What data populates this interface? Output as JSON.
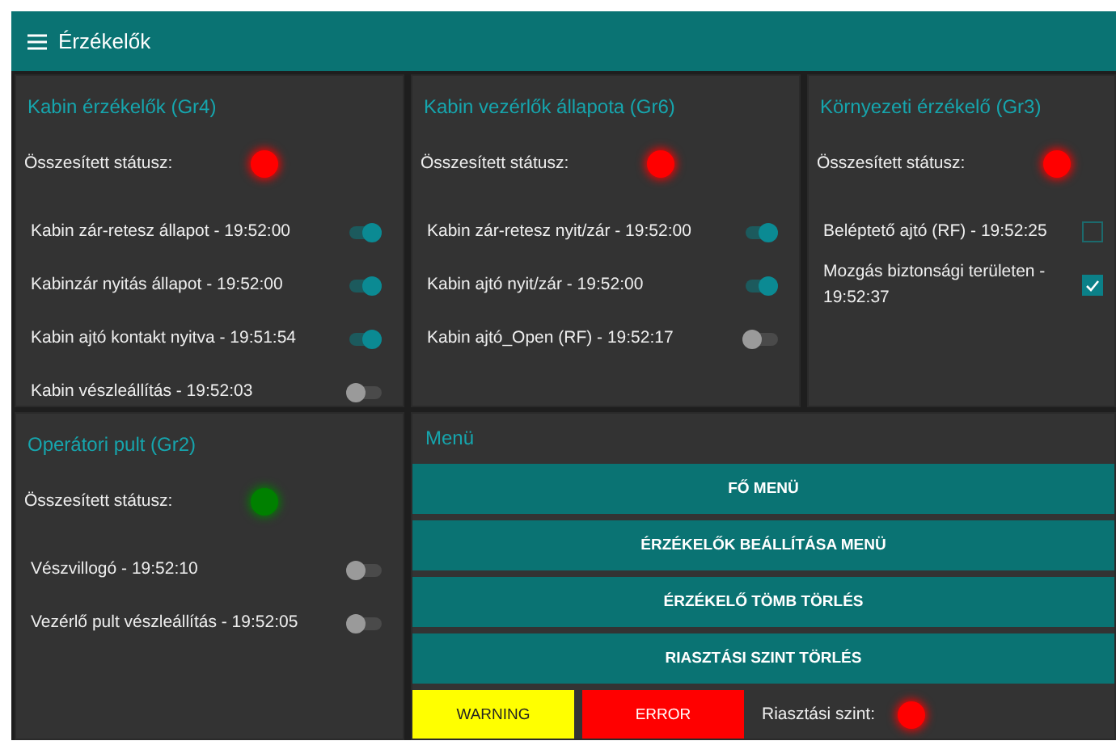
{
  "header": {
    "title": "Érzékelők"
  },
  "panels": [
    {
      "title": "Kabin érzékelők (Gr4)",
      "status": {
        "label": "Összesített státusz:",
        "color": "#ff0000"
      },
      "items": [
        {
          "kind": "toggle",
          "label": "Kabin zár-retesz állapot - 19:52:00",
          "on": true
        },
        {
          "kind": "toggle",
          "label": "Kabinzár nyitás állapot - 19:52:00",
          "on": true
        },
        {
          "kind": "toggle",
          "label": "Kabin ajtó kontakt nyitva - 19:51:54",
          "on": true
        },
        {
          "kind": "toggle",
          "label": "Kabin vészleállítás - 19:52:03",
          "on": false
        }
      ]
    },
    {
      "title": "Kabin vezérlők állapota (Gr6)",
      "status": {
        "label": "Összesített státusz:",
        "color": "#ff0000"
      },
      "items": [
        {
          "kind": "toggle",
          "label": "Kabin zár-retesz nyit/zár - 19:52:00",
          "on": true
        },
        {
          "kind": "toggle",
          "label": "Kabin ajtó nyit/zár - 19:52:00",
          "on": true
        },
        {
          "kind": "toggle",
          "label": "Kabin ajtó_Open (RF) - 19:52:17",
          "on": false
        }
      ]
    },
    {
      "title": "Környezeti érzékelő (Gr3)",
      "status": {
        "label": "Összesített státusz:",
        "color": "#ff0000"
      },
      "items": [
        {
          "kind": "checkbox",
          "label": "Beléptető ajtó (RF) - 19:52:25",
          "checked": false
        },
        {
          "kind": "checkbox",
          "label": "Mozgás biztonsági területen - 19:52:37",
          "checked": true
        }
      ]
    },
    {
      "title": "Operátori pult (Gr2)",
      "status": {
        "label": "Összesített státusz:",
        "color": "#008000"
      },
      "items": [
        {
          "kind": "toggle",
          "label": "Vészvillogó - 19:52:10",
          "on": false
        },
        {
          "kind": "toggle",
          "label": "Vezérlő pult vészleállítás - 19:52:05",
          "on": false
        }
      ]
    }
  ],
  "menu": {
    "title": "Menü",
    "buttons": [
      "FŐ MENÜ",
      "ÉRZÉKELŐK BEÁLLÍTÁSA MENÜ",
      "ÉRZÉKELŐ TÖMB TÖRLÉS",
      "RIASZTÁSI SZINT TÖRLÉS"
    ],
    "alerts": [
      {
        "label": "WARNING",
        "color": "#ffff00"
      },
      {
        "label": "ERROR",
        "color": "#ff0000"
      }
    ],
    "alarm": {
      "label": "Riasztási szint:",
      "color": "#ff0000"
    }
  }
}
